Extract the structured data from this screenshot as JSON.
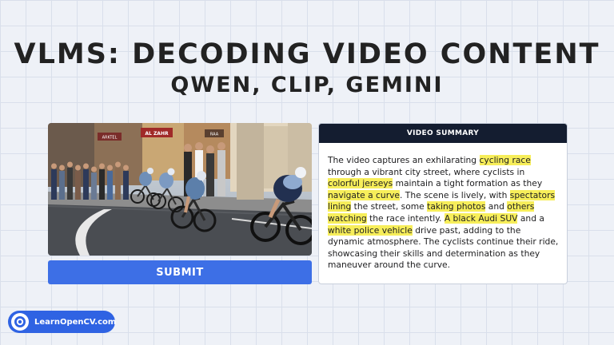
{
  "header": {
    "title": "VLMS: DECODING VIDEO CONTENT",
    "subtitle": "QWEN, CLIP, GEMINI"
  },
  "video": {
    "shop_signs": [
      "AL ZAHR",
      "ARKTEL",
      "RAA"
    ]
  },
  "submit": {
    "label": "SUBMIT"
  },
  "summary": {
    "heading": "VIDEO SUMMARY",
    "segments": [
      {
        "text": "The video captures an exhilarating ",
        "highlight": false
      },
      {
        "text": "cycling race",
        "highlight": true
      },
      {
        "text": " through a vibrant city street, where cyclists in ",
        "highlight": false
      },
      {
        "text": "colorful jerseys",
        "highlight": true
      },
      {
        "text": " maintain a tight formation as they ",
        "highlight": false
      },
      {
        "text": "navigate a curve",
        "highlight": true
      },
      {
        "text": ". The scene is lively, with ",
        "highlight": false
      },
      {
        "text": "spectators lining",
        "highlight": true
      },
      {
        "text": " the street, some ",
        "highlight": false
      },
      {
        "text": "taking photos",
        "highlight": true
      },
      {
        "text": " and ",
        "highlight": false
      },
      {
        "text": "others watching",
        "highlight": true
      },
      {
        "text": " the race intently. ",
        "highlight": false
      },
      {
        "text": "A black Audi SUV",
        "highlight": true
      },
      {
        "text": " and a ",
        "highlight": false
      },
      {
        "text": "white police vehicle",
        "highlight": true
      },
      {
        "text": " drive past, adding to the dynamic atmosphere. The cyclists continue their ride, showcasing their skills and determination as they maneuver around the curve.",
        "highlight": false
      }
    ],
    "highlight_color": "#f7ee5a"
  },
  "brand": {
    "label": "LearnOpenCV.com",
    "icon": "eye-logo-icon",
    "color": "#2f63e3"
  },
  "colors": {
    "accent": "#3d6fe6",
    "summary_header_bg": "#141d30"
  }
}
